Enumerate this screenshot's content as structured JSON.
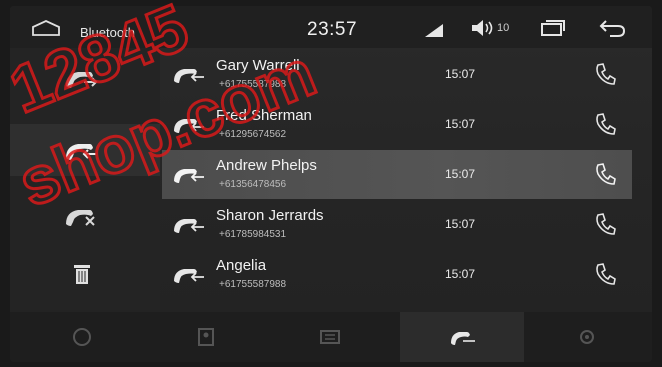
{
  "status_bar": {
    "app_title": "Bluetooth",
    "clock": "23:57",
    "volume_level": "10",
    "icons": [
      "home-icon",
      "signal-icon",
      "volume-icon",
      "window-icon",
      "back-icon"
    ]
  },
  "left_rail": {
    "items": [
      {
        "name": "outgoing-calls",
        "icon": "outgoing-call-icon",
        "active": false
      },
      {
        "name": "incoming-calls",
        "icon": "incoming-call-icon",
        "active": true
      },
      {
        "name": "missed-calls",
        "icon": "missed-call-icon",
        "active": false
      },
      {
        "name": "delete",
        "icon": "trash-icon",
        "active": false
      }
    ]
  },
  "call_log": {
    "rows": [
      {
        "name": "Gary Warrell",
        "number": "+61755587988",
        "time": "15:07",
        "selected": false
      },
      {
        "name": "Fred Sherman",
        "number": "+61295674562",
        "time": "15:07",
        "selected": false
      },
      {
        "name": "Andrew Phelps",
        "number": "+61356478456",
        "time": "15:07",
        "selected": true
      },
      {
        "name": "Sharon Jerrards",
        "number": "+61785984531",
        "time": "15:07",
        "selected": false
      },
      {
        "name": "Angelia",
        "number": "+61755587988",
        "time": "15:07",
        "selected": false
      }
    ]
  },
  "bottom_tabs": {
    "items": [
      {
        "icon": "keypad-icon",
        "active": false
      },
      {
        "icon": "contacts-icon",
        "active": false
      },
      {
        "icon": "music-icon",
        "active": false
      },
      {
        "icon": "call-log-icon",
        "active": true
      },
      {
        "icon": "settings-icon",
        "active": false
      }
    ]
  },
  "colors": {
    "background": "#262626",
    "selected_row": "#555555",
    "watermark": "#d81a1a",
    "text": "#f2f2f2"
  },
  "watermark": {
    "line1": "12845",
    "line2": "shop.com"
  }
}
